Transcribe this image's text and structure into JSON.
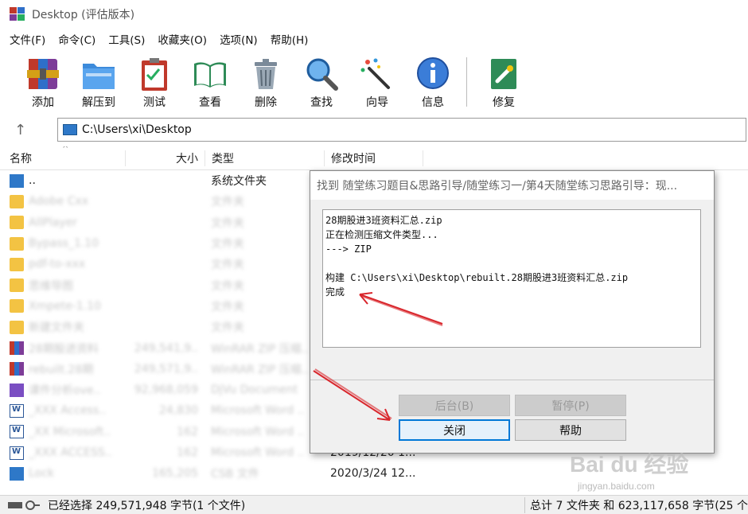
{
  "window": {
    "title": "Desktop (评估版本)"
  },
  "menu": [
    "文件(F)",
    "命令(C)",
    "工具(S)",
    "收藏夹(O)",
    "选项(N)",
    "帮助(H)"
  ],
  "toolbar": {
    "add": "添加",
    "extract": "解压到",
    "test": "测试",
    "view": "查看",
    "delete": "删除",
    "find": "查找",
    "wizard": "向导",
    "info": "信息",
    "repair": "修复"
  },
  "address": {
    "path": "C:\\Users\\xi\\Desktop"
  },
  "columns": {
    "name": "名称",
    "size": "大小",
    "type": "类型",
    "modified": "修改时间"
  },
  "rows": [
    {
      "name": "..",
      "size": "",
      "type": "系统文件夹",
      "time": "",
      "icon": "drive",
      "blur": false
    },
    {
      "name": "Adobe Cxx",
      "size": "",
      "type": "文件夹",
      "time": "",
      "icon": "folder",
      "blur": true
    },
    {
      "name": "AllPlayer",
      "size": "",
      "type": "文件夹",
      "time": "",
      "icon": "folder",
      "blur": true
    },
    {
      "name": "Bypass_1.10",
      "size": "",
      "type": "文件夹",
      "time": "",
      "icon": "folder",
      "blur": true
    },
    {
      "name": "pdf-to-xxx",
      "size": "",
      "type": "文件夹",
      "time": "",
      "icon": "folder",
      "blur": true
    },
    {
      "name": "思维导图",
      "size": "",
      "type": "文件夹",
      "time": "",
      "icon": "folder",
      "blur": true
    },
    {
      "name": "Xmpete-1.10",
      "size": "",
      "type": "文件夹",
      "time": "",
      "icon": "folder",
      "blur": true
    },
    {
      "name": "新建文件夹",
      "size": "",
      "type": "文件夹",
      "time": "",
      "icon": "folder",
      "blur": true
    },
    {
      "name": "28期股进资料",
      "size": "249,541,9..",
      "type": "WinRAR ZIP 压缩..",
      "time": "",
      "icon": "rar",
      "blur": true
    },
    {
      "name": "rebuilt.28期",
      "size": "249,571,9..",
      "type": "WinRAR ZIP 压缩..",
      "time": "",
      "icon": "rar",
      "blur": true
    },
    {
      "name": "课件分析ove..",
      "size": "92,968,059",
      "type": "DjVu Document",
      "time": "",
      "icon": "purple",
      "blur": true
    },
    {
      "name": "_XXX Access..",
      "size": "24,830",
      "type": "Microsoft Word ..",
      "time": "",
      "icon": "docx",
      "blur": true
    },
    {
      "name": "_XX Microsoft..",
      "size": "162",
      "type": "Microsoft Word ..",
      "time": "",
      "icon": "docx",
      "blur": true
    },
    {
      "name": "_XXX ACCESS..",
      "size": "162",
      "type": "Microsoft Word ..",
      "time": "2019/12/20 1...",
      "icon": "docx",
      "blur": true
    },
    {
      "name": "Lock",
      "size": "165,205",
      "type": "CSB 文件",
      "time": "2020/3/24 12...",
      "icon": "blue",
      "blur": true
    }
  ],
  "dialog": {
    "title": "找到 随堂练习题目&思路引导/随堂练习一/第4天随堂练习思路引导：现...",
    "log": [
      "28期股进3班资料汇总.zip",
      "正在检测压缩文件类型...",
      "---> ZIP",
      "",
      "构建 C:\\Users\\xi\\Desktop\\rebuilt.28期股进3班资料汇总.zip",
      "完成"
    ],
    "background_label": "后台(B)",
    "pause_label": "暂停(P)",
    "close_label": "关闭",
    "help_label": "帮助"
  },
  "status": {
    "selected": "已经选择 249,571,948 字节(1 个文件)",
    "total": "总计 7 文件夹 和 623,117,658 字节(25 个"
  },
  "watermark": {
    "main": "Bai du 经验",
    "sub": "jingyan.baidu.com"
  },
  "colors": {
    "accent": "#0078d7",
    "arrow": "#d9262c",
    "folder": "#f3c343"
  }
}
